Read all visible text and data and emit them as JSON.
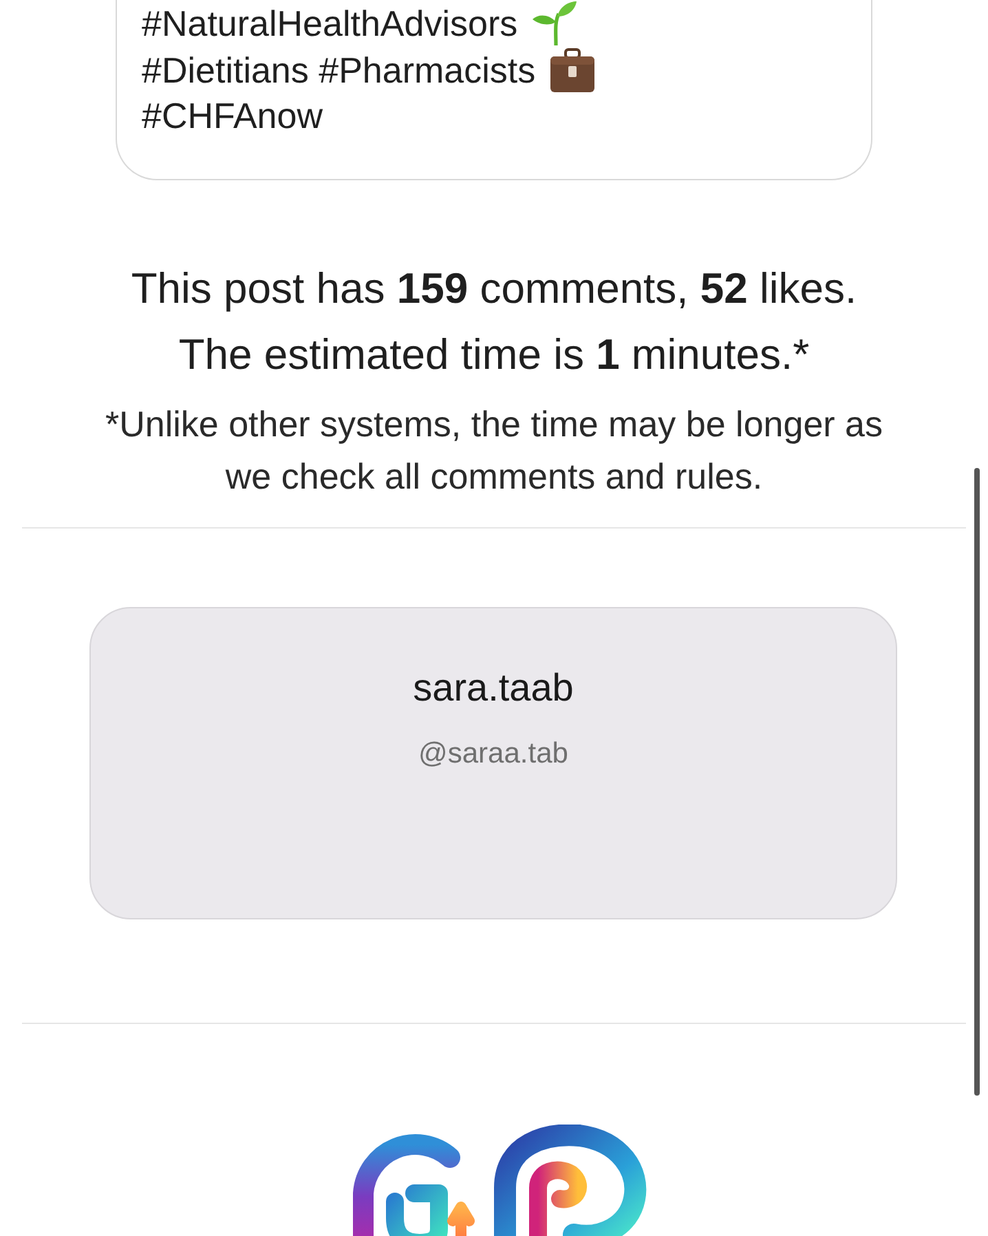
{
  "post_card": {
    "lines": [
      {
        "text": "#NaturalHealthAdvisors",
        "kind": "sprout"
      },
      {
        "text": "#Dietitians #Pharmacists",
        "kind": "briefcase"
      },
      {
        "text": "#CHFAnow",
        "kind": "plain"
      }
    ]
  },
  "summary": {
    "lines": [
      "This post has **159** comments, **52** likes.",
      "The estimated time is **1** minutes.*"
    ],
    "footnote": "*Unlike other systems, the time may be longer as we check all comments and rules."
  },
  "profile": {
    "name": "sara.taab",
    "handle": "@saraa.tab"
  }
}
